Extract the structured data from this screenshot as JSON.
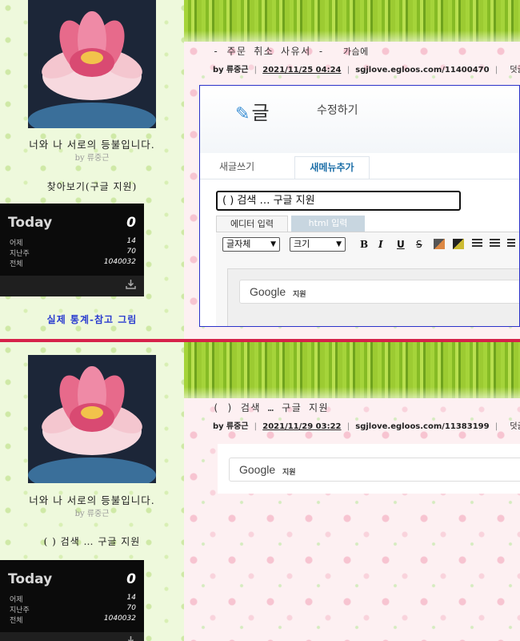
{
  "top": {
    "profile": {
      "name": "너와 나 서로의 등불입니다.",
      "by": "by 류중근"
    },
    "sidebar_heading": "찾아보기(구글 지원)",
    "today": {
      "label": "Today",
      "value": "0",
      "rows": [
        {
          "label": "어제",
          "value": "14"
        },
        {
          "label": "지난주",
          "value": "70"
        },
        {
          "label": "전체",
          "value": "1040032"
        }
      ]
    },
    "sidebar_link": "실제 통계-참고 그림",
    "post": {
      "title": "- 주문 취소 사유서 -",
      "category": "가슴에",
      "by": "by",
      "author": "류중근",
      "date": "2021/11/25 04:24",
      "url": "sgjlove.egloos.com/11400470",
      "comment": "덧글"
    },
    "screenshot": {
      "logo_text": "글",
      "edit_title": "수정하기",
      "tab_write": "새글쓰기",
      "tab_menu": "새메뉴추가",
      "title_value": "( ) 검색 … 구글 지원",
      "editor_tab_a": "에디터 입력",
      "editor_tab_b": "html 입력",
      "font_select": "글자체",
      "size_select": "크기",
      "toolbar": [
        "B",
        "I",
        "U",
        "S"
      ],
      "google_logo": "Google",
      "google_sub": "지원"
    }
  },
  "bottom": {
    "profile": {
      "name": "너와 나 서로의 등불입니다.",
      "by": "by 류중근"
    },
    "sidebar_heading": "( ) 검색 … 구글 지원",
    "today": {
      "label": "Today",
      "value": "0",
      "rows": [
        {
          "label": "어제",
          "value": "14"
        },
        {
          "label": "지난주",
          "value": "70"
        },
        {
          "label": "전체",
          "value": "1040032"
        }
      ]
    },
    "post": {
      "title": "( ) 검색 … 구글 지원",
      "by": "by",
      "author": "류중근",
      "date": "2021/11/29 03:22",
      "url": "sgjlove.egloos.com/11383199",
      "comment": "덧글"
    },
    "google_logo": "Google",
    "google_sub": "지원"
  },
  "icons": {
    "download": "download-icon",
    "pen": "pen-icon"
  },
  "colors": {
    "divider": "#d6224a",
    "link": "#2a3ccf",
    "frame": "#2b32c9"
  }
}
